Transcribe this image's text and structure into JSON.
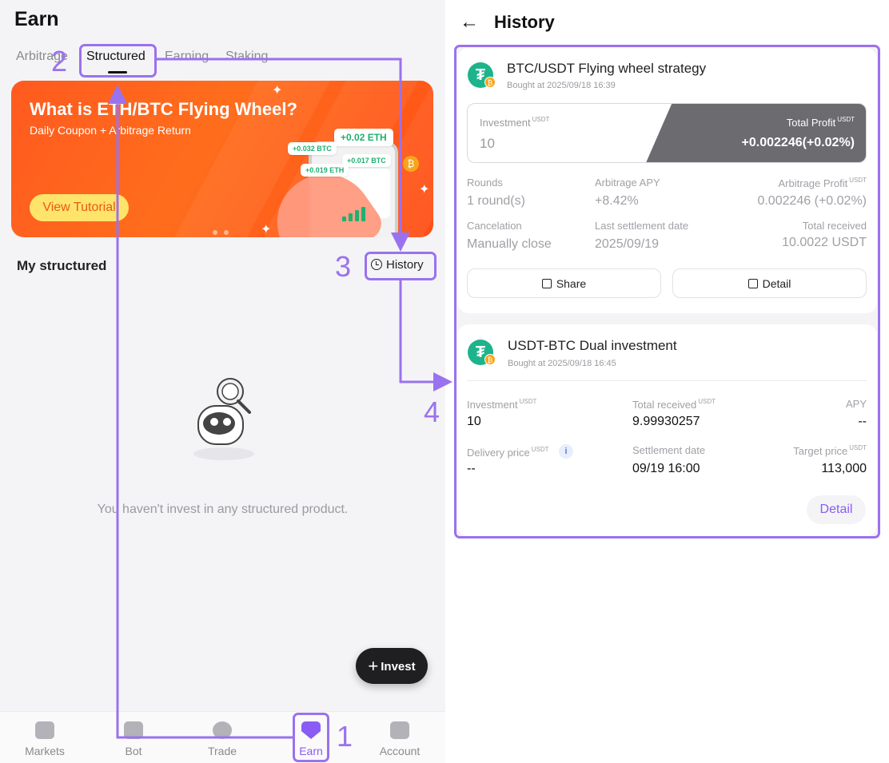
{
  "left": {
    "title": "Earn",
    "tabs": [
      "Arbitrage",
      "Structured",
      "Earning",
      "Staking"
    ],
    "banner": {
      "title": "What is ETH/BTC Flying Wheel?",
      "subtitle": "Daily Coupon + Arbitrage Return",
      "button": "View Tutorial",
      "chips": [
        "+0.02 ETH",
        "+0.032 BTC",
        "+0.017 BTC",
        "+0.019 ETH"
      ]
    },
    "section_title": "My structured",
    "history_label": "History",
    "empty_text": "You haven't invest in any structured product.",
    "invest_label": "Invest",
    "nav": [
      "Markets",
      "Bot",
      "Trade",
      "Earn",
      "Account"
    ]
  },
  "right": {
    "title": "History",
    "card1": {
      "name": "BTC/USDT Flying wheel strategy",
      "bought": "Bought at 2025/09/18 16:39",
      "investment_label": "Investment",
      "investment_value": "10",
      "unit": "USDT",
      "total_profit_label": "Total Profit",
      "total_profit_value": "+0.002246(+0.02%)",
      "rounds_label": "Rounds",
      "rounds_value": "1 round(s)",
      "apy_label": "Arbitrage APY",
      "apy_value": "+8.42%",
      "profit_label": "Arbitrage Profit",
      "profit_value": "0.002246 (+0.02%)",
      "cancel_label": "Cancelation",
      "cancel_value": "Manually close",
      "settle_label": "Last settlement date",
      "settle_value": "2025/09/19",
      "received_label": "Total received",
      "received_value": "10.0022 USDT",
      "share_btn": "Share",
      "detail_btn": "Detail"
    },
    "card2": {
      "name": "USDT-BTC Dual investment",
      "bought": "Bought at 2025/09/18 16:45",
      "investment_label": "Investment",
      "investment_value": "10",
      "received_label": "Total received",
      "received_value": "9.99930257",
      "apy_label": "APY",
      "apy_value": "--",
      "delivery_label": "Delivery price",
      "delivery_value": "--",
      "settle_label": "Settlement date",
      "settle_value": "09/19 16:00",
      "target_label": "Target price",
      "target_value": "113,000",
      "unit": "USDT",
      "detail_btn": "Detail"
    }
  },
  "annotations": [
    "1",
    "2",
    "3",
    "4"
  ],
  "colors": {
    "accent": "#9a72ee",
    "banner": "#ff5a1f",
    "green": "#1eb070",
    "tether": "#1db38b"
  }
}
